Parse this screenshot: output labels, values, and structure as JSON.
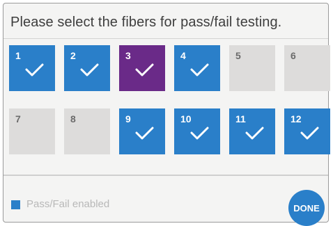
{
  "title": "Please select the fibers for pass/fail testing.",
  "fibers": [
    {
      "label": "1",
      "state": "enabled"
    },
    {
      "label": "2",
      "state": "enabled"
    },
    {
      "label": "3",
      "state": "selected"
    },
    {
      "label": "4",
      "state": "enabled"
    },
    {
      "label": "5",
      "state": "disabled"
    },
    {
      "label": "6",
      "state": "disabled"
    },
    {
      "label": "7",
      "state": "disabled"
    },
    {
      "label": "8",
      "state": "disabled"
    },
    {
      "label": "9",
      "state": "enabled"
    },
    {
      "label": "10",
      "state": "enabled"
    },
    {
      "label": "11",
      "state": "enabled"
    },
    {
      "label": "12",
      "state": "enabled"
    }
  ],
  "legend": {
    "label": "Pass/Fail enabled"
  },
  "done_button": {
    "label": "DONE"
  },
  "colors": {
    "enabled": "#2a7fc9",
    "selected": "#6a2a88",
    "disabled": "#dddcdb",
    "panel_background": "#f4f4f3"
  },
  "icons": {
    "check": "checkmark-icon"
  }
}
